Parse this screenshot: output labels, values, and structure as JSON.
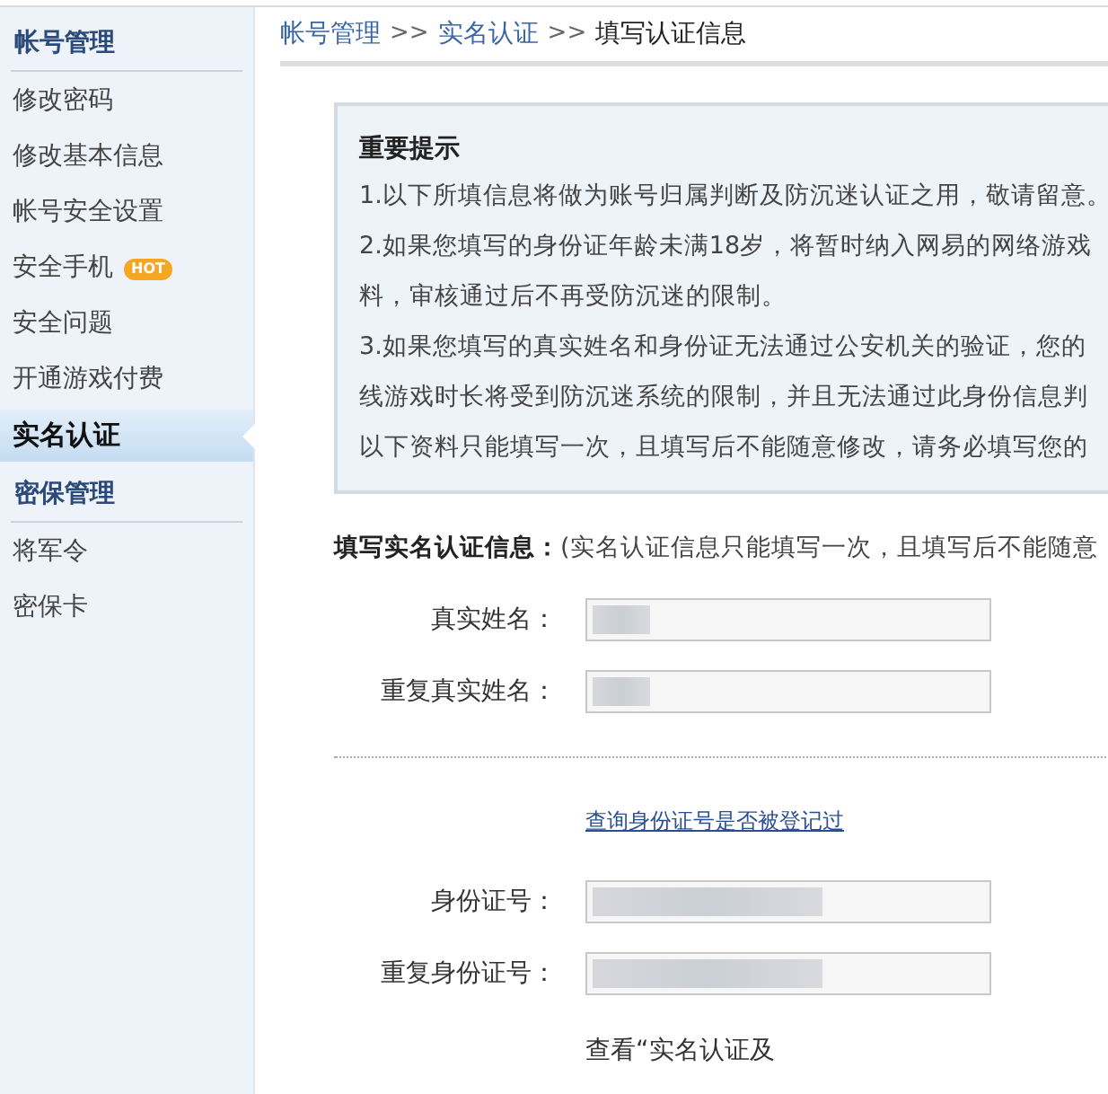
{
  "sidebar": {
    "groups": [
      {
        "title": "帐号管理",
        "items": [
          {
            "label": "修改密码",
            "selected": false
          },
          {
            "label": "修改基本信息",
            "selected": false
          },
          {
            "label": "帐号安全设置",
            "selected": false
          },
          {
            "label": "安全手机",
            "selected": false,
            "badge": "HOT"
          },
          {
            "label": "安全问题",
            "selected": false
          },
          {
            "label": "开通游戏付费",
            "selected": false
          },
          {
            "label": "实名认证",
            "selected": true
          }
        ]
      },
      {
        "title": "密保管理",
        "items": [
          {
            "label": "将军令",
            "selected": false
          },
          {
            "label": "密保卡",
            "selected": false
          }
        ]
      }
    ]
  },
  "breadcrumb": [
    {
      "kind": "link",
      "text": "帐号管理"
    },
    {
      "kind": "separator",
      "text": ">>"
    },
    {
      "kind": "link",
      "text": "实名认证"
    },
    {
      "kind": "separator",
      "text": ">>"
    },
    {
      "kind": "current",
      "text": "填写认证信息"
    }
  ],
  "notice": {
    "title": "重要提示",
    "lines": [
      "1.以下所填信息将做为账号归属判断及防沉迷认证之用，敬请留意。",
      "2.如果您填写的身份证年龄未满18岁，将暂时纳入网易的网络游戏",
      "料，审核通过后不再受防沉迷的限制。",
      "3.如果您填写的真实姓名和身份证无法通过公安机关的验证，您的",
      "线游戏时长将受到防沉迷系统的限制，并且无法通过此身份信息判",
      "以下资料只能填写一次，且填写后不能随意修改，请务必填写您的"
    ]
  },
  "form": {
    "heading": "填写实名认证信息：",
    "heading_note": "(实名认证信息只能填写一次，且填写后不能随意",
    "name_fields": [
      {
        "label": "真实姓名："
      },
      {
        "label": "重复真实姓名："
      }
    ],
    "check_link": "查询身份证号是否被登记过",
    "id_fields": [
      {
        "label": "身份证号："
      },
      {
        "label": "重复身份证号："
      }
    ],
    "footer_text": "查看“实名认证及"
  }
}
